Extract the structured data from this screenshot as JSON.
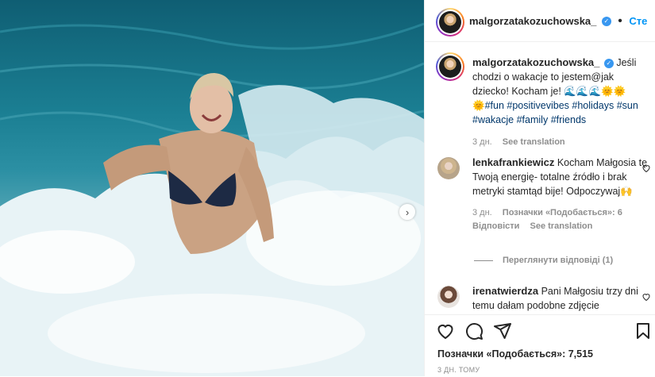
{
  "post": {
    "author": "malgorzatakozuchowska_",
    "verified_mark": "✓",
    "follow_label": "Сте",
    "more_label": "···",
    "caption_username": "malgorzatakozuchowska_",
    "caption_text": "Jeśli chodzi o wakacje to jestem@jak dziecko! Kocham je! 🌊🌊🌊🌞🌞",
    "caption_sun": "🌞",
    "hashtags": [
      "#fun",
      "#positivevibes",
      "#holidays",
      "#sun",
      "#wakacje",
      "#family",
      "#friends"
    ],
    "caption_age": "3 дн.",
    "see_translation": "See translation",
    "likes_text": "Позначки «Подобається»: 7,515",
    "date_text": "3 ДН. ТОМУ"
  },
  "comments": [
    {
      "username": "lenkafrankiewicz",
      "text": "Kocham Małgosia tę Twoją energię- totalne źródło i brak metryki stamtąd bije! Odpoczywaj🙌",
      "age": "3 дн.",
      "likes": "Позначки «Подобається»: 6",
      "reply": "Відповісти",
      "translate": "See translation"
    },
    {
      "username": "irenatwierdza",
      "text": "Pani Małgosiu trzy dni temu dałam podobne zdjęcie"
    }
  ],
  "view_replies": "Переглянути відповіді (1)",
  "colors": {
    "link": "#0095f6",
    "hashtag": "#00376b",
    "muted": "#8e8e8e",
    "text": "#262626"
  },
  "icons": {
    "like": "heart-icon",
    "comment": "comment-icon",
    "share": "paper-plane-icon",
    "save": "bookmark-icon",
    "next": "chevron-right-icon"
  }
}
